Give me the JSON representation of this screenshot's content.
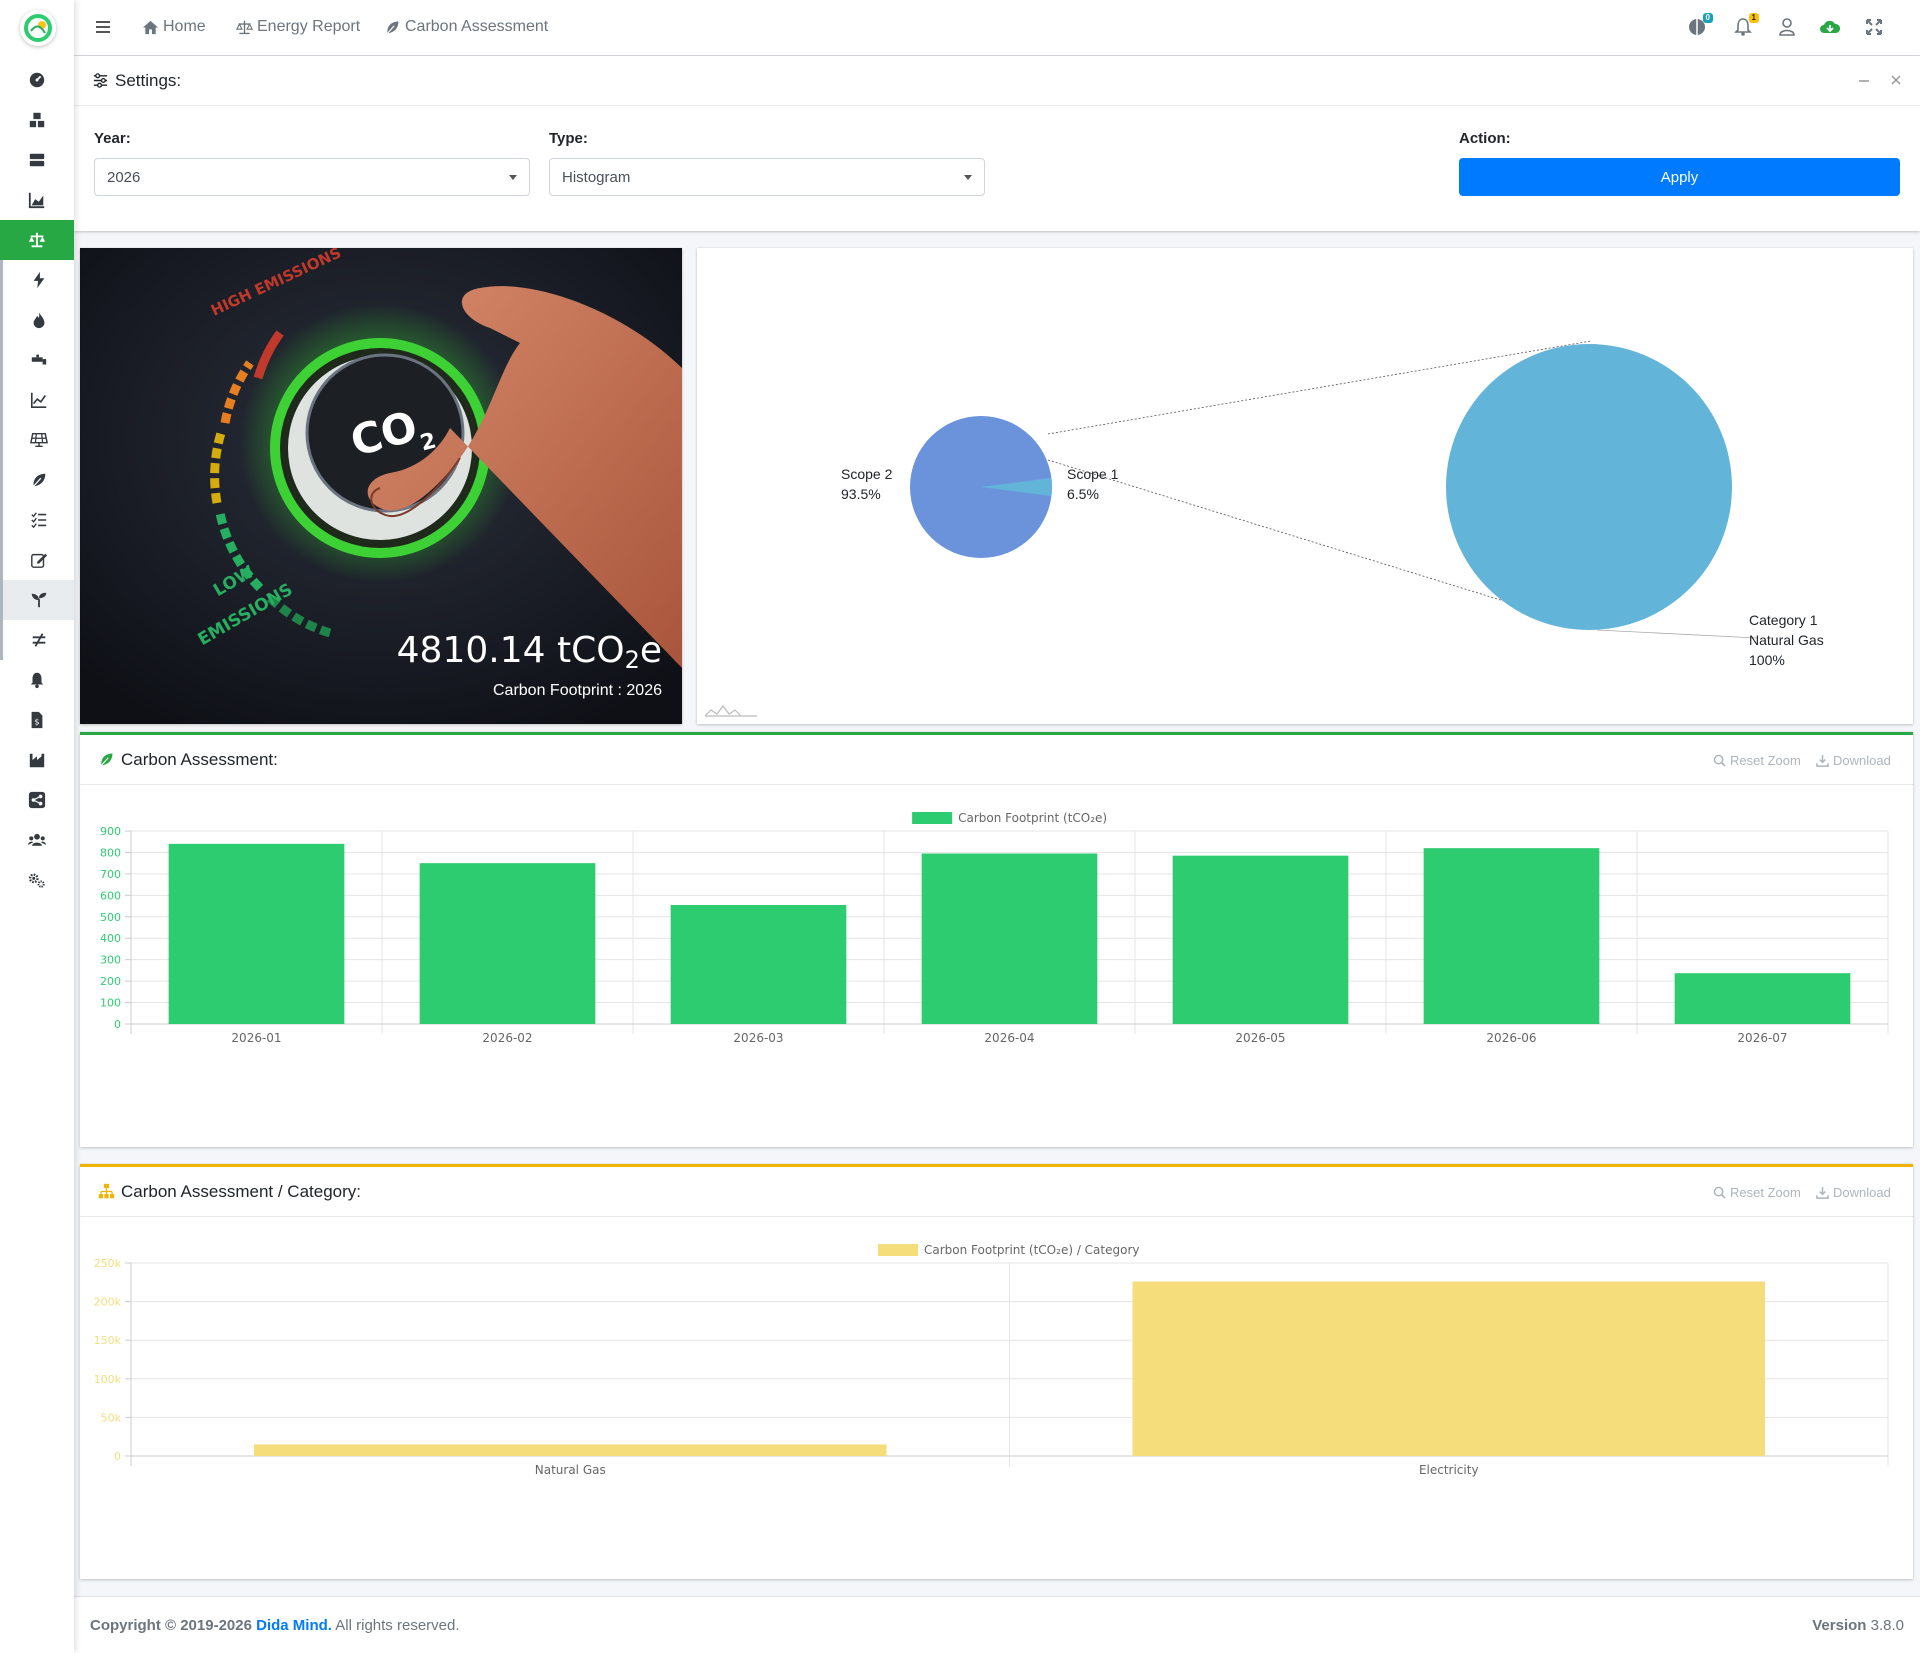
{
  "navbar": {
    "breadcrumbs": [
      {
        "label": "Home",
        "icon": "home-icon"
      },
      {
        "label": "Energy Report",
        "icon": "balance-scale-icon"
      },
      {
        "label": "Carbon Assessment",
        "icon": "leaf-icon"
      }
    ],
    "badges": {
      "global": "0",
      "notifications": "1"
    }
  },
  "settings": {
    "title": "Settings:",
    "year_label": "Year:",
    "year_value": "2026",
    "type_label": "Type:",
    "type_value": "Histogram",
    "action_label": "Action:",
    "apply_label": "Apply"
  },
  "hero": {
    "value": "4810.14 tCO",
    "value_sub": "2",
    "value_unit": "e",
    "caption": "Carbon Footprint : 2026",
    "dial_text": "CO",
    "dial_sub": "2",
    "high_text": "HIGH EMISSIONS",
    "low_text_1": "LOW",
    "low_text_2": "EMISSIONS"
  },
  "pie": {
    "scopes": [
      {
        "name": "Scope 2",
        "pct": "93.5%",
        "value": 93.5,
        "color": "#6a93dc"
      },
      {
        "name": "Scope 1",
        "pct": "6.5%",
        "value": 6.5,
        "color": "#62b4d9"
      }
    ],
    "breakdown": {
      "line1": "Category 1",
      "line2": "Natural Gas",
      "pct": "100%",
      "color": "#62b4d9"
    }
  },
  "assessment": {
    "title": "Carbon Assessment:",
    "reset_zoom": "Reset Zoom",
    "download": "Download"
  },
  "category": {
    "title": "Carbon Assessment / Category:",
    "reset_zoom": "Reset Zoom",
    "download": "Download"
  },
  "footer": {
    "copyright": "Copyright © 2019-2026",
    "brand": "Dida Mind.",
    "rights": " All rights reserved.",
    "version_label": "Version",
    "version": "3.8.0"
  },
  "colors": {
    "green": "#2ecc71",
    "yellow": "#f5dd7c",
    "primary": "#007bff",
    "active": "#28a745"
  },
  "chart_data": [
    {
      "type": "bar",
      "legend": "Carbon Footprint (tCO₂e)",
      "categories": [
        "2026-01",
        "2026-02",
        "2026-03",
        "2026-04",
        "2026-05",
        "2026-06",
        "2026-07"
      ],
      "values": [
        840,
        750,
        555,
        795,
        785,
        820,
        237
      ],
      "yticks": [
        "0",
        "100",
        "200",
        "300",
        "400",
        "500",
        "600",
        "700",
        "800",
        "900"
      ],
      "ylim": [
        0,
        900
      ],
      "grid": true,
      "color": "#2ecc71"
    },
    {
      "type": "bar",
      "legend": "Carbon Footprint (tCO₂e) / Category",
      "categories": [
        "Natural Gas",
        "Electricity"
      ],
      "values": [
        15000,
        226000
      ],
      "yticks": [
        "0",
        "50k",
        "100k",
        "150k",
        "200k",
        "250k"
      ],
      "ylim": [
        0,
        250000
      ],
      "grid": true,
      "color": "#f5dd7c"
    }
  ]
}
